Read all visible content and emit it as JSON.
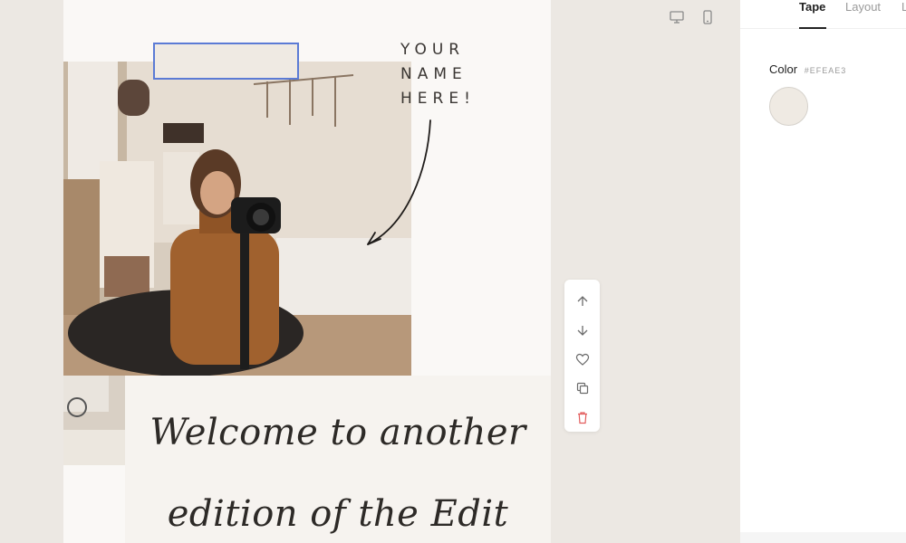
{
  "canvas": {
    "name_text": "YOUR\nNAME\nHERE!",
    "script_line1": "Welcome to another",
    "script_line2": "edition of the Edit"
  },
  "tape": {
    "color": "#EFEAE3"
  },
  "device_toggle": {
    "desktop_icon": "desktop-icon",
    "mobile_icon": "mobile-icon"
  },
  "floating_toolbar": {
    "buttons": [
      "arrow-up-icon",
      "arrow-down-icon",
      "heart-icon",
      "duplicate-icon",
      "trash-icon"
    ],
    "delete_color": "#e25c5c"
  },
  "panel": {
    "tabs": [
      "Tape",
      "Layout",
      "L"
    ],
    "active_tab": "Tape",
    "color_label": "Color",
    "color_hex": "#EFEAE3"
  }
}
